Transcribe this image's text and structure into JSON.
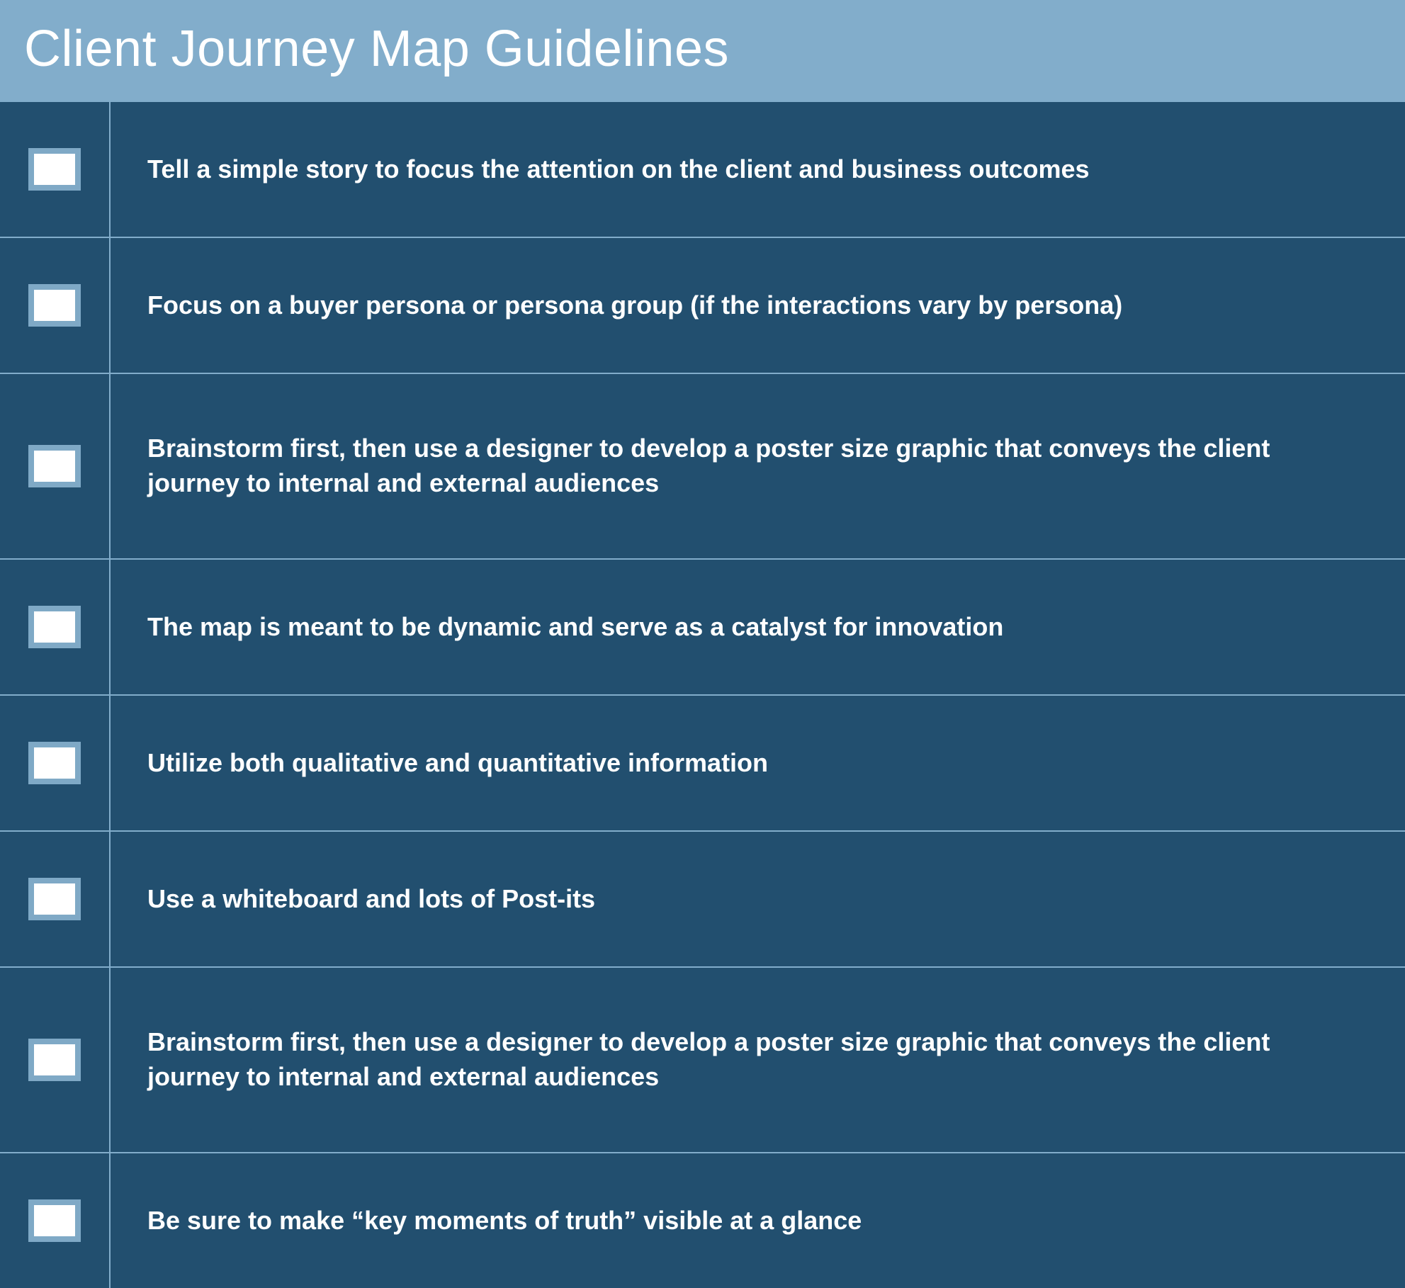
{
  "header": {
    "title": "Client Journey Map Guidelines"
  },
  "items": [
    {
      "text": "Tell a simple story to focus the attention on the client and business outcomes",
      "tall": false
    },
    {
      "text": "Focus on a buyer persona or persona group (if the interactions vary by persona)",
      "tall": false
    },
    {
      "text": "Brainstorm first, then use a designer to develop a poster size graphic that conveys the client journey to internal and external audiences",
      "tall": true
    },
    {
      "text": "The map is meant to be dynamic and serve as a catalyst for innovation",
      "tall": false
    },
    {
      "text": "Utilize both qualitative and quantitative information",
      "tall": false
    },
    {
      "text": "Use a whiteboard and lots of Post-its",
      "tall": false
    },
    {
      "text": "Brainstorm first, then use a designer to develop a poster size graphic that conveys the client journey to internal and external audiences",
      "tall": true
    },
    {
      "text": "Be sure to make “key moments of truth” visible at a glance",
      "tall": false
    }
  ]
}
